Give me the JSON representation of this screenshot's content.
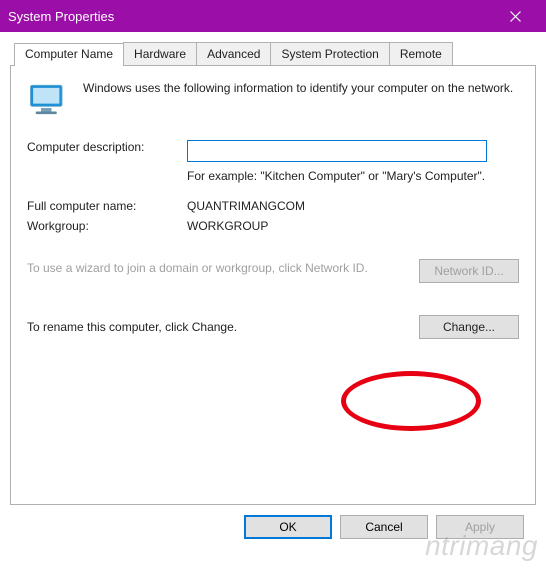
{
  "title": "System Properties",
  "tabs": [
    "Computer Name",
    "Hardware",
    "Advanced",
    "System Protection",
    "Remote"
  ],
  "active_tab": 0,
  "intro_text": "Windows uses the following information to identify your computer on the network.",
  "desc_label": "Computer description:",
  "desc_value": "",
  "desc_hint": "For example: \"Kitchen Computer\" or \"Mary's Computer\".",
  "fullname_label": "Full computer name:",
  "fullname_value": "QUANTRIMANGCOM",
  "workgroup_label": "Workgroup:",
  "workgroup_value": "WORKGROUP",
  "wizard_text": "To use a wizard to join a domain or workgroup, click Network ID.",
  "networkid_label": "Network ID...",
  "rename_text": "To rename this computer, click Change.",
  "change_label": "Change...",
  "buttons": {
    "ok": "OK",
    "cancel": "Cancel",
    "apply": "Apply"
  }
}
